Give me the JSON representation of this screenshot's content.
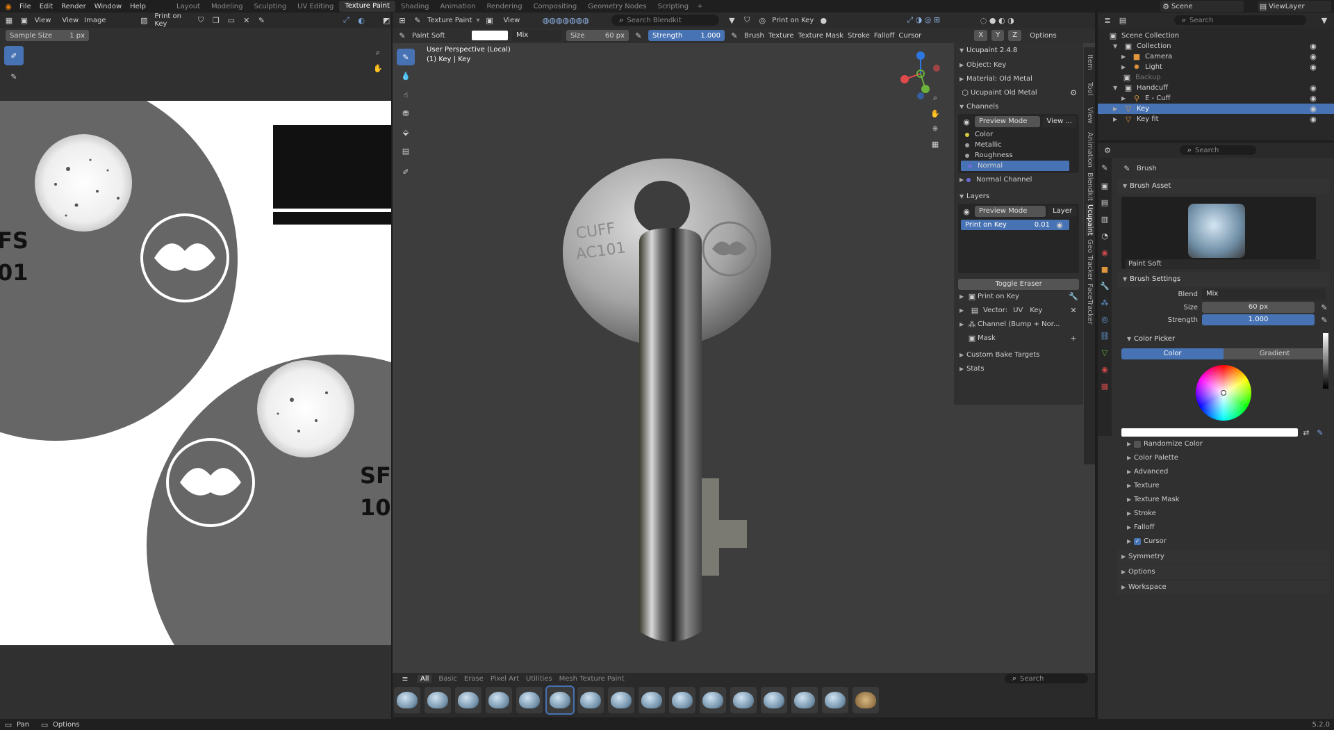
{
  "top_menu": {
    "items": [
      "File",
      "Edit",
      "Render",
      "Window",
      "Help"
    ],
    "workspaces": [
      "Layout",
      "Modeling",
      "Sculpting",
      "UV Editing",
      "Texture Paint",
      "Shading",
      "Animation",
      "Rendering",
      "Compositing",
      "Geometry Nodes",
      "Scripting"
    ],
    "active_workspace": "Texture Paint",
    "scene_label": "Scene",
    "viewlayer_label": "ViewLayer"
  },
  "image_editor": {
    "header_menus": [
      "View",
      "View",
      "Image"
    ],
    "mode_label": "Print on Key",
    "sample_size_label": "Sample Size",
    "sample_size_value": "1 px",
    "text_fs": "FS",
    "text_01": "01",
    "text_fs_mirror": "SF",
    "text_01_mirror": "10"
  },
  "viewport": {
    "mode": "Texture Paint",
    "view_menu": "View",
    "search_placeholder": "Search Blendkit",
    "print_label": "Print on Key",
    "brush_name": "Paint Soft",
    "blend": "Mix",
    "size_label": "Size",
    "size_value": "60 px",
    "strength_label": "Strength",
    "strength_value": "1.000",
    "menus": [
      "Brush",
      "Texture",
      "Texture Mask",
      "Stroke",
      "Falloff",
      "Cursor"
    ],
    "axes": [
      "X",
      "Y",
      "Z"
    ],
    "options_label": "Options",
    "perspective": "User Perspective (Local)",
    "object_info": "(1) Key | Key",
    "version": "5.2.0"
  },
  "side_tabs": [
    "Item",
    "Tool",
    "View",
    "Animation",
    "Blendkit",
    "Ucupaint",
    "Geo Tracker",
    "FaceTracker"
  ],
  "ucupaint": {
    "title": "Ucupaint 2.4.8",
    "object": "Object: Key",
    "material": "Material: Old Metal",
    "node": "Ucupaint Old Metal",
    "channels_title": "Channels",
    "preview_mode": "Preview Mode",
    "view_dd": "View ...",
    "channels": [
      {
        "name": "Color",
        "color": "#d6c840"
      },
      {
        "name": "Metallic",
        "color": "#a0a0a0"
      },
      {
        "name": "Roughness",
        "color": "#a0a0a0"
      },
      {
        "name": "Normal",
        "color": "#6c6cd8"
      }
    ],
    "active_channel": "Normal",
    "normal_channel": "Normal Channel",
    "layers_title": "Layers",
    "layer_dd": "Layer",
    "layer_name": "Print on Key",
    "layer_value": "0.01",
    "toggle_eraser": "Toggle Eraser",
    "props": {
      "print": "Print on Key",
      "vector_label": "Vector:",
      "vector_uv": "UV",
      "vector_key": "Key",
      "channel": "Channel (Bump + Nor...",
      "mask": "Mask"
    },
    "custom_bake": "Custom Bake Targets",
    "stats": "Stats"
  },
  "brush_bar": {
    "tabs": [
      "All",
      "Basic",
      "Erase",
      "Pixel Art",
      "Utilities",
      "Mesh Texture Paint"
    ],
    "active_tab": "All",
    "search_placeholder": "Search",
    "count": 16
  },
  "outliner": {
    "search_placeholder": "Search",
    "items": [
      {
        "label": "Scene Collection",
        "depth": 0,
        "icon": "collection"
      },
      {
        "label": "Collection",
        "depth": 1,
        "icon": "collection"
      },
      {
        "label": "Camera",
        "depth": 2,
        "icon": "camera"
      },
      {
        "label": "Light",
        "depth": 2,
        "icon": "light"
      },
      {
        "label": "Backup",
        "depth": 1,
        "icon": "collection",
        "dim": true
      },
      {
        "label": "Handcuff",
        "depth": 1,
        "icon": "collection"
      },
      {
        "label": "E - Cuff",
        "depth": 2,
        "icon": "armature"
      },
      {
        "label": "Key",
        "depth": 1,
        "icon": "mesh",
        "selected": true
      },
      {
        "label": "Key fit",
        "depth": 1,
        "icon": "mesh"
      }
    ]
  },
  "properties": {
    "search_placeholder": "Search",
    "brush_header": "Brush",
    "brush_asset": "Brush Asset",
    "brush_name": "Paint Soft",
    "brush_settings": "Brush Settings",
    "blend_label": "Blend",
    "blend_value": "Mix",
    "size_label": "Size",
    "size_value": "60 px",
    "strength_label": "Strength",
    "strength_value": "1.000",
    "strength_level": 1.0,
    "color_picker": "Color Picker",
    "tab_color": "Color",
    "tab_gradient": "Gradient",
    "randomize": "Randomize Color",
    "sections": [
      "Color Palette",
      "Advanced",
      "Texture",
      "Texture Mask",
      "Stroke",
      "Falloff",
      "Cursor"
    ],
    "bottom_sections": [
      "Symmetry",
      "Options",
      "Workspace"
    ]
  },
  "statusbar": {
    "pan": "Pan",
    "options": "Options",
    "version": "5.2.0"
  }
}
